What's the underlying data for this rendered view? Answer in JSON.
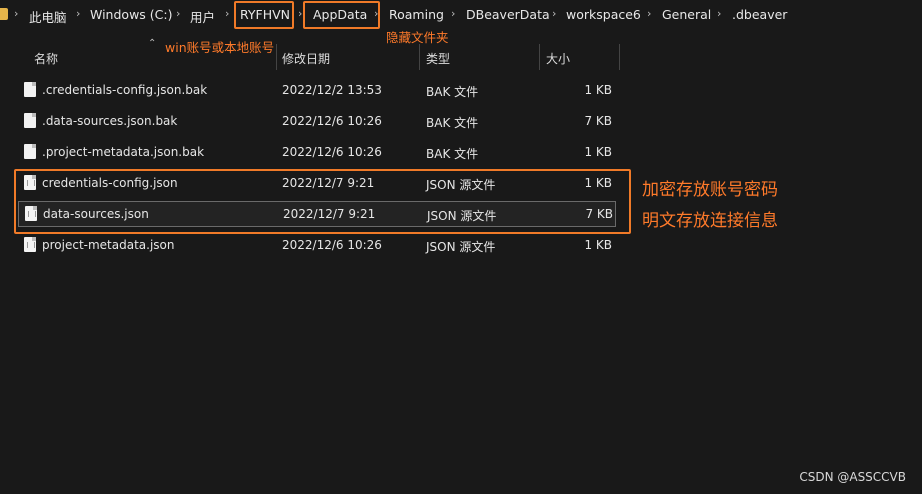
{
  "breadcrumb": {
    "items": [
      "此电脑",
      "Windows (C:)",
      "用户",
      "RYFHVN",
      "AppData",
      "Roaming",
      "DBeaverData",
      "workspace6",
      "General",
      ".dbeaver"
    ],
    "separator": "›"
  },
  "annotations": {
    "user_note": "win账号或本地账号",
    "hidden_note": "隐藏文件夹",
    "encrypted_note": "加密存放账号密码",
    "plain_note": "明文存放连接信息"
  },
  "columns": {
    "name": "名称",
    "date": "修改日期",
    "type": "类型",
    "size": "大小"
  },
  "files": [
    {
      "name": ".credentials-config.json.bak",
      "date": "2022/12/2 13:53",
      "type": "BAK 文件",
      "size": "1 KB",
      "icon": "file-icon"
    },
    {
      "name": ".data-sources.json.bak",
      "date": "2022/12/6 10:26",
      "type": "BAK 文件",
      "size": "7 KB",
      "icon": "file-icon"
    },
    {
      "name": ".project-metadata.json.bak",
      "date": "2022/12/6 10:26",
      "type": "BAK 文件",
      "size": "1 KB",
      "icon": "file-icon"
    },
    {
      "name": "credentials-config.json",
      "date": "2022/12/7 9:21",
      "type": "JSON 源文件",
      "size": "1 KB",
      "icon": "json-file-icon"
    },
    {
      "name": "data-sources.json",
      "date": "2022/12/7 9:21",
      "type": "JSON 源文件",
      "size": "7 KB",
      "icon": "json-file-icon"
    },
    {
      "name": "project-metadata.json",
      "date": "2022/12/6 10:26",
      "type": "JSON 源文件",
      "size": "1 KB",
      "icon": "json-file-icon"
    }
  ],
  "watermark": "CSDN @ASSCCVB",
  "colors": {
    "background": "#191919",
    "highlight": "#f07a28",
    "annotation": "#ff7a2a"
  }
}
